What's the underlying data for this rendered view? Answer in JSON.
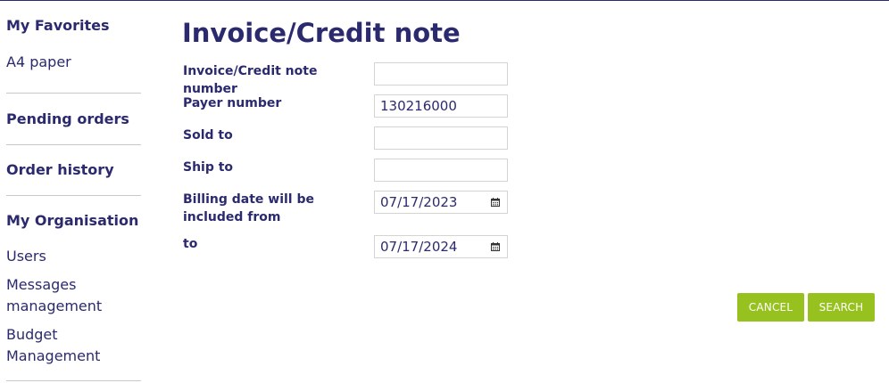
{
  "sidebar": {
    "favorites_heading": "My Favorites",
    "favorites_items": [
      "A4 paper"
    ],
    "pending_orders": "Pending orders",
    "order_history": "Order history",
    "organisation_heading": "My Organisation",
    "organisation_items": [
      "Users",
      "Messages management",
      "Budget Management"
    ]
  },
  "main": {
    "title": "Invoice/Credit note",
    "fields": {
      "invoice_number": {
        "label": "Invoice/Credit note number",
        "value": ""
      },
      "payer_number": {
        "label": "Payer number",
        "value": "130216000"
      },
      "sold_to": {
        "label": "Sold to",
        "value": ""
      },
      "ship_to": {
        "label": "Ship to",
        "value": ""
      },
      "billing_from": {
        "label": "Billing date will be included from",
        "value": "07/17/2023"
      },
      "billing_to": {
        "label": "to",
        "value": "07/17/2024"
      }
    },
    "buttons": {
      "cancel": "CANCEL",
      "search": "SEARCH"
    }
  },
  "colors": {
    "text": "#2b2a6e",
    "button": "#96c11f",
    "divider": "#c8c8c8"
  },
  "icons": {
    "date_picker": "calendar-icon"
  }
}
